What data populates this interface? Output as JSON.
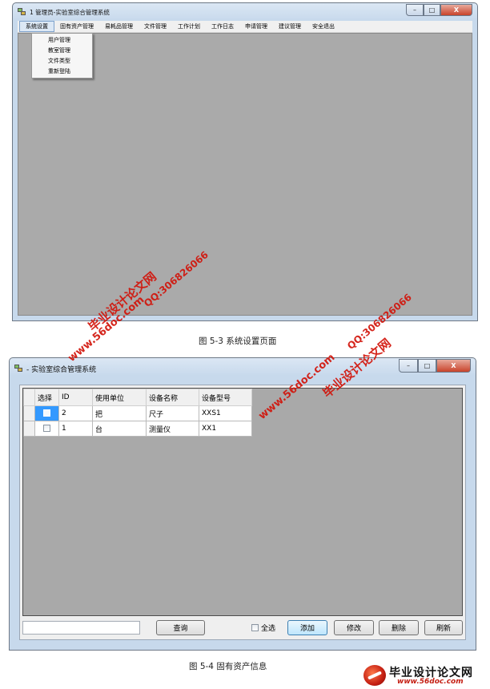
{
  "window1": {
    "title": "1 管理员-实验室综合管理系统",
    "controls": {
      "min": "–",
      "max": "□",
      "close": "X"
    },
    "menu": [
      "系统设置",
      "固有资产管理",
      "易耗品管理",
      "文件管理",
      "工作计划",
      "工作日志",
      "申请管理",
      "建议管理",
      "安全退出"
    ],
    "dropdown": [
      "用户管理",
      "教室管理",
      "文件类型",
      "重新登陆"
    ]
  },
  "caption1": "图 5-3  系统设置页面",
  "window2": {
    "title": "- 实验室综合管理系统",
    "controls": {
      "min": "–",
      "max": "□",
      "close": "X"
    },
    "grid": {
      "columns": [
        "选择",
        "ID",
        "使用单位",
        "设备名称",
        "设备型号"
      ],
      "rows": [
        {
          "id": "2",
          "unit": "把",
          "name": "尺子",
          "model": "XXS1"
        },
        {
          "id": "1",
          "unit": "台",
          "name": "测量仪",
          "model": "XX1"
        }
      ]
    },
    "search_value": "",
    "query_button": "查询",
    "select_all": "全选",
    "buttons": {
      "add": "添加",
      "edit": "修改",
      "delete": "删除",
      "refresh": "刷新"
    }
  },
  "caption2": "图 5-4  固有资产信息",
  "watermarks": {
    "site_cn": "毕业设计论文网",
    "site_url": "www.56doc.com",
    "qq": "QQ:306826066"
  },
  "logo": {
    "text": "毕业设计论文网",
    "url": "www.56doc.com"
  }
}
